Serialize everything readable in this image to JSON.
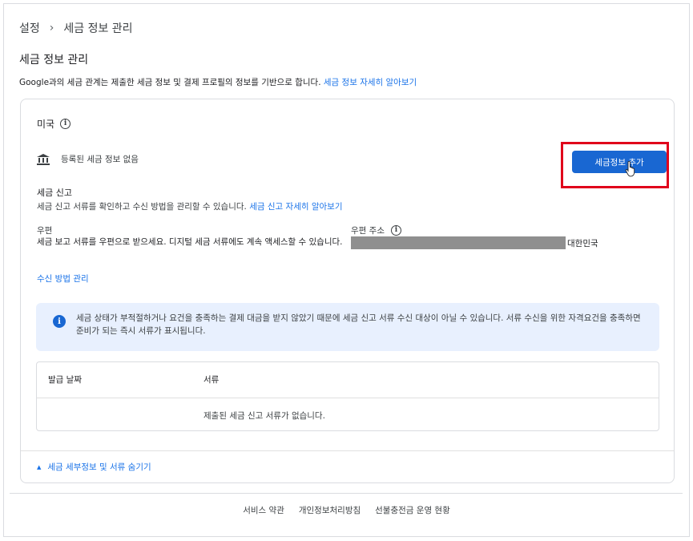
{
  "breadcrumb": {
    "root": "설정",
    "separator": "›",
    "current": "세금 정보 관리"
  },
  "page_title": "세금 정보 관리",
  "intro": {
    "text": "Google과의 세금 관계는 제출한 세금 정보 및 결제 프로필의 정보를 기반으로 합니다. ",
    "link": "세금 정보 자세히 알아보기"
  },
  "card": {
    "country": "미국",
    "no_tax_info": "등록된 세금 정보 없음",
    "add_button": "세금정보 추가",
    "tax_filing": {
      "title": "세금 신고",
      "desc": "세금 신고 서류를 확인하고 수신 방법을 관리할 수 있습니다. ",
      "link": "세금 신고 자세히 알아보기"
    },
    "mail": {
      "label": "우편",
      "desc": "세금 보고 서류를 우편으로 받으세요. 디지털 세금 서류에도 계속 액세스할 수 있습니다."
    },
    "address": {
      "label": "우편 주소",
      "country": "대한민국"
    },
    "manage_link": "수신 방법 관리",
    "notice": "세금 상태가 부적절하거나 요건을 충족하는 결제 대금을 받지 않았기 때문에 세금 신고 서류 수신 대상이 아닐 수 있습니다. 서류 수신을 위한 자격요건을 충족하면 준비가 되는 즉시 서류가 표시됩니다.",
    "table": {
      "headers": [
        "발급 날짜",
        "서류"
      ],
      "empty": "제출된 세금 신고 서류가 없습니다."
    },
    "toggle": "세금 세부정보 및 서류 숨기기"
  },
  "footer": [
    "서비스 약관",
    "개인정보처리방침",
    "선불충전금 운영 현황"
  ],
  "colors": {
    "accent": "#1a73e8",
    "button": "#1967d2",
    "highlight": "#e0001b",
    "notice_bg": "#e8f0fe"
  }
}
